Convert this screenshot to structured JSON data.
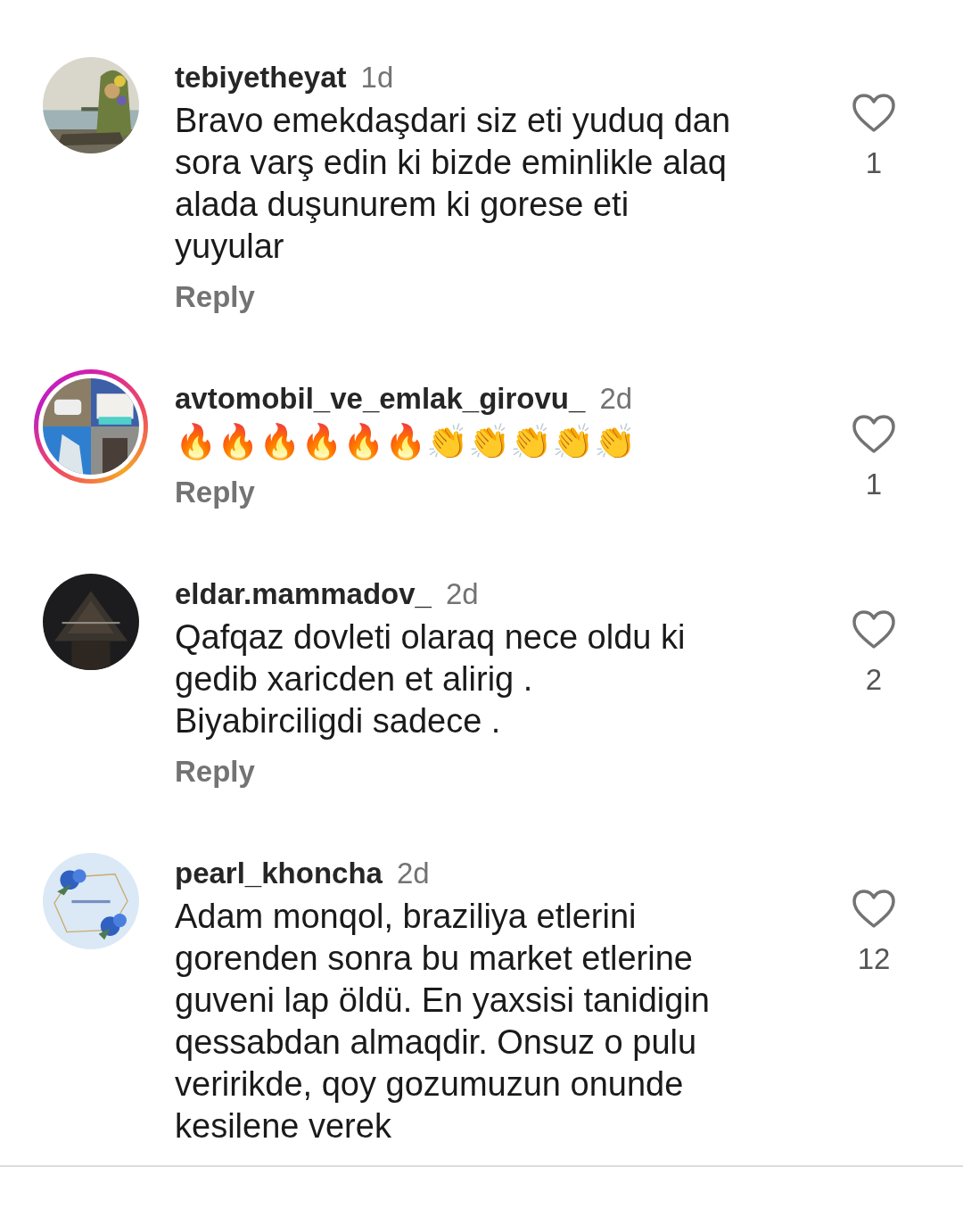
{
  "comments": [
    {
      "username": "tebiyetheyat",
      "time": "1d",
      "avatar": {
        "kind": "picture",
        "story_ring": false
      },
      "lines": [
        "Bravo emekdaşdari siz eti yuduq dan",
        "sora varş edin  ki bizde eminlikle alaq",
        "alada duşunurem ki gorese eti",
        "yuyular"
      ],
      "reply": "Reply",
      "likes": "1",
      "liked": false
    },
    {
      "username": "avtomobil_ve_emlak_girovu_",
      "time": "2d",
      "avatar": {
        "kind": "picture",
        "story_ring": true
      },
      "lines": [
        "🔥🔥🔥🔥🔥🔥👏👏👏👏👏"
      ],
      "reply": "Reply",
      "likes": "1",
      "liked": false
    },
    {
      "username": "eldar.mammadov_",
      "time": "2d",
      "avatar": {
        "kind": "picture",
        "story_ring": false
      },
      "lines": [
        "Qafqaz dovleti olaraq nece oldu ki",
        "gedib xaricden et alirig .",
        "Biyabirciligdi sadece ."
      ],
      "reply": "Reply",
      "likes": "2",
      "liked": false
    },
    {
      "username": "pearl_khoncha",
      "time": "2d",
      "avatar": {
        "kind": "picture",
        "story_ring": false
      },
      "lines": [
        "Adam monqol, braziliya etlerini",
        "gorenden sonra  bu market etlerine",
        "guveni lap öldü. En yaxsisi tanidigin",
        "qessabdan almaqdir. Onsuz o pulu",
        "veririkde, qoy gozumuzun onunde",
        "kesilene verek"
      ],
      "likes": "12",
      "liked": false
    }
  ]
}
